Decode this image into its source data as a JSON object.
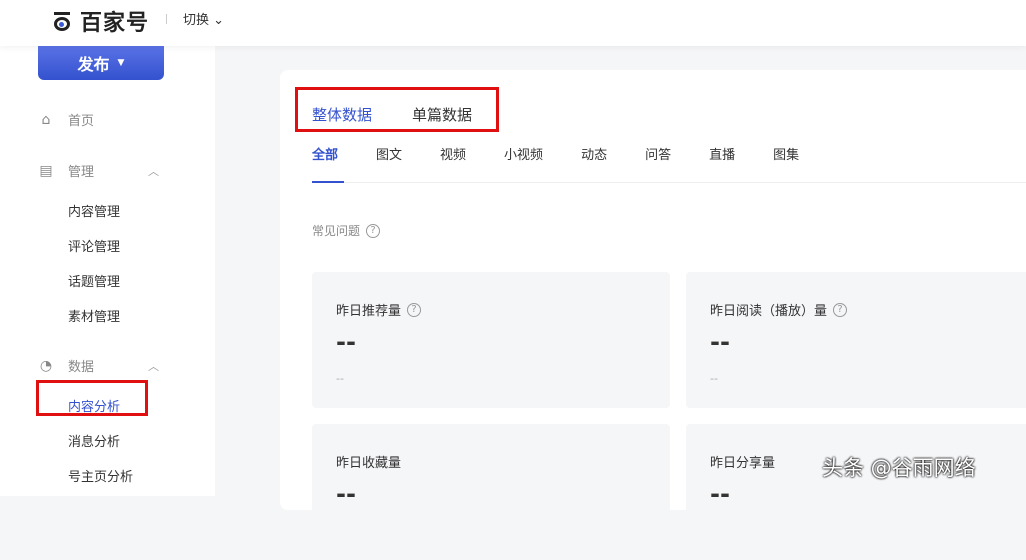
{
  "header": {
    "logo": "百家号",
    "switch": "切换"
  },
  "sidebar": {
    "publish": "发布",
    "home": "首页",
    "manage": "管理",
    "manage_items": [
      "内容管理",
      "评论管理",
      "话题管理",
      "素材管理"
    ],
    "data": "数据",
    "data_items": [
      "内容分析",
      "消息分析",
      "号主页分析"
    ]
  },
  "main": {
    "top_tabs": [
      "整体数据",
      "单篇数据"
    ],
    "sub_tabs": [
      "全部",
      "图文",
      "视频",
      "小视频",
      "动态",
      "问答",
      "直播",
      "图集"
    ],
    "faq": "常见问题",
    "stats": [
      {
        "label": "昨日推荐量",
        "value": "--",
        "sub": "--"
      },
      {
        "label": "昨日阅读（播放）量",
        "value": "--",
        "sub": "--"
      },
      {
        "label": "昨日收藏量",
        "value": "--"
      },
      {
        "label": "昨日分享量",
        "value": "--"
      }
    ]
  },
  "watermark": "头条 @谷雨网络"
}
